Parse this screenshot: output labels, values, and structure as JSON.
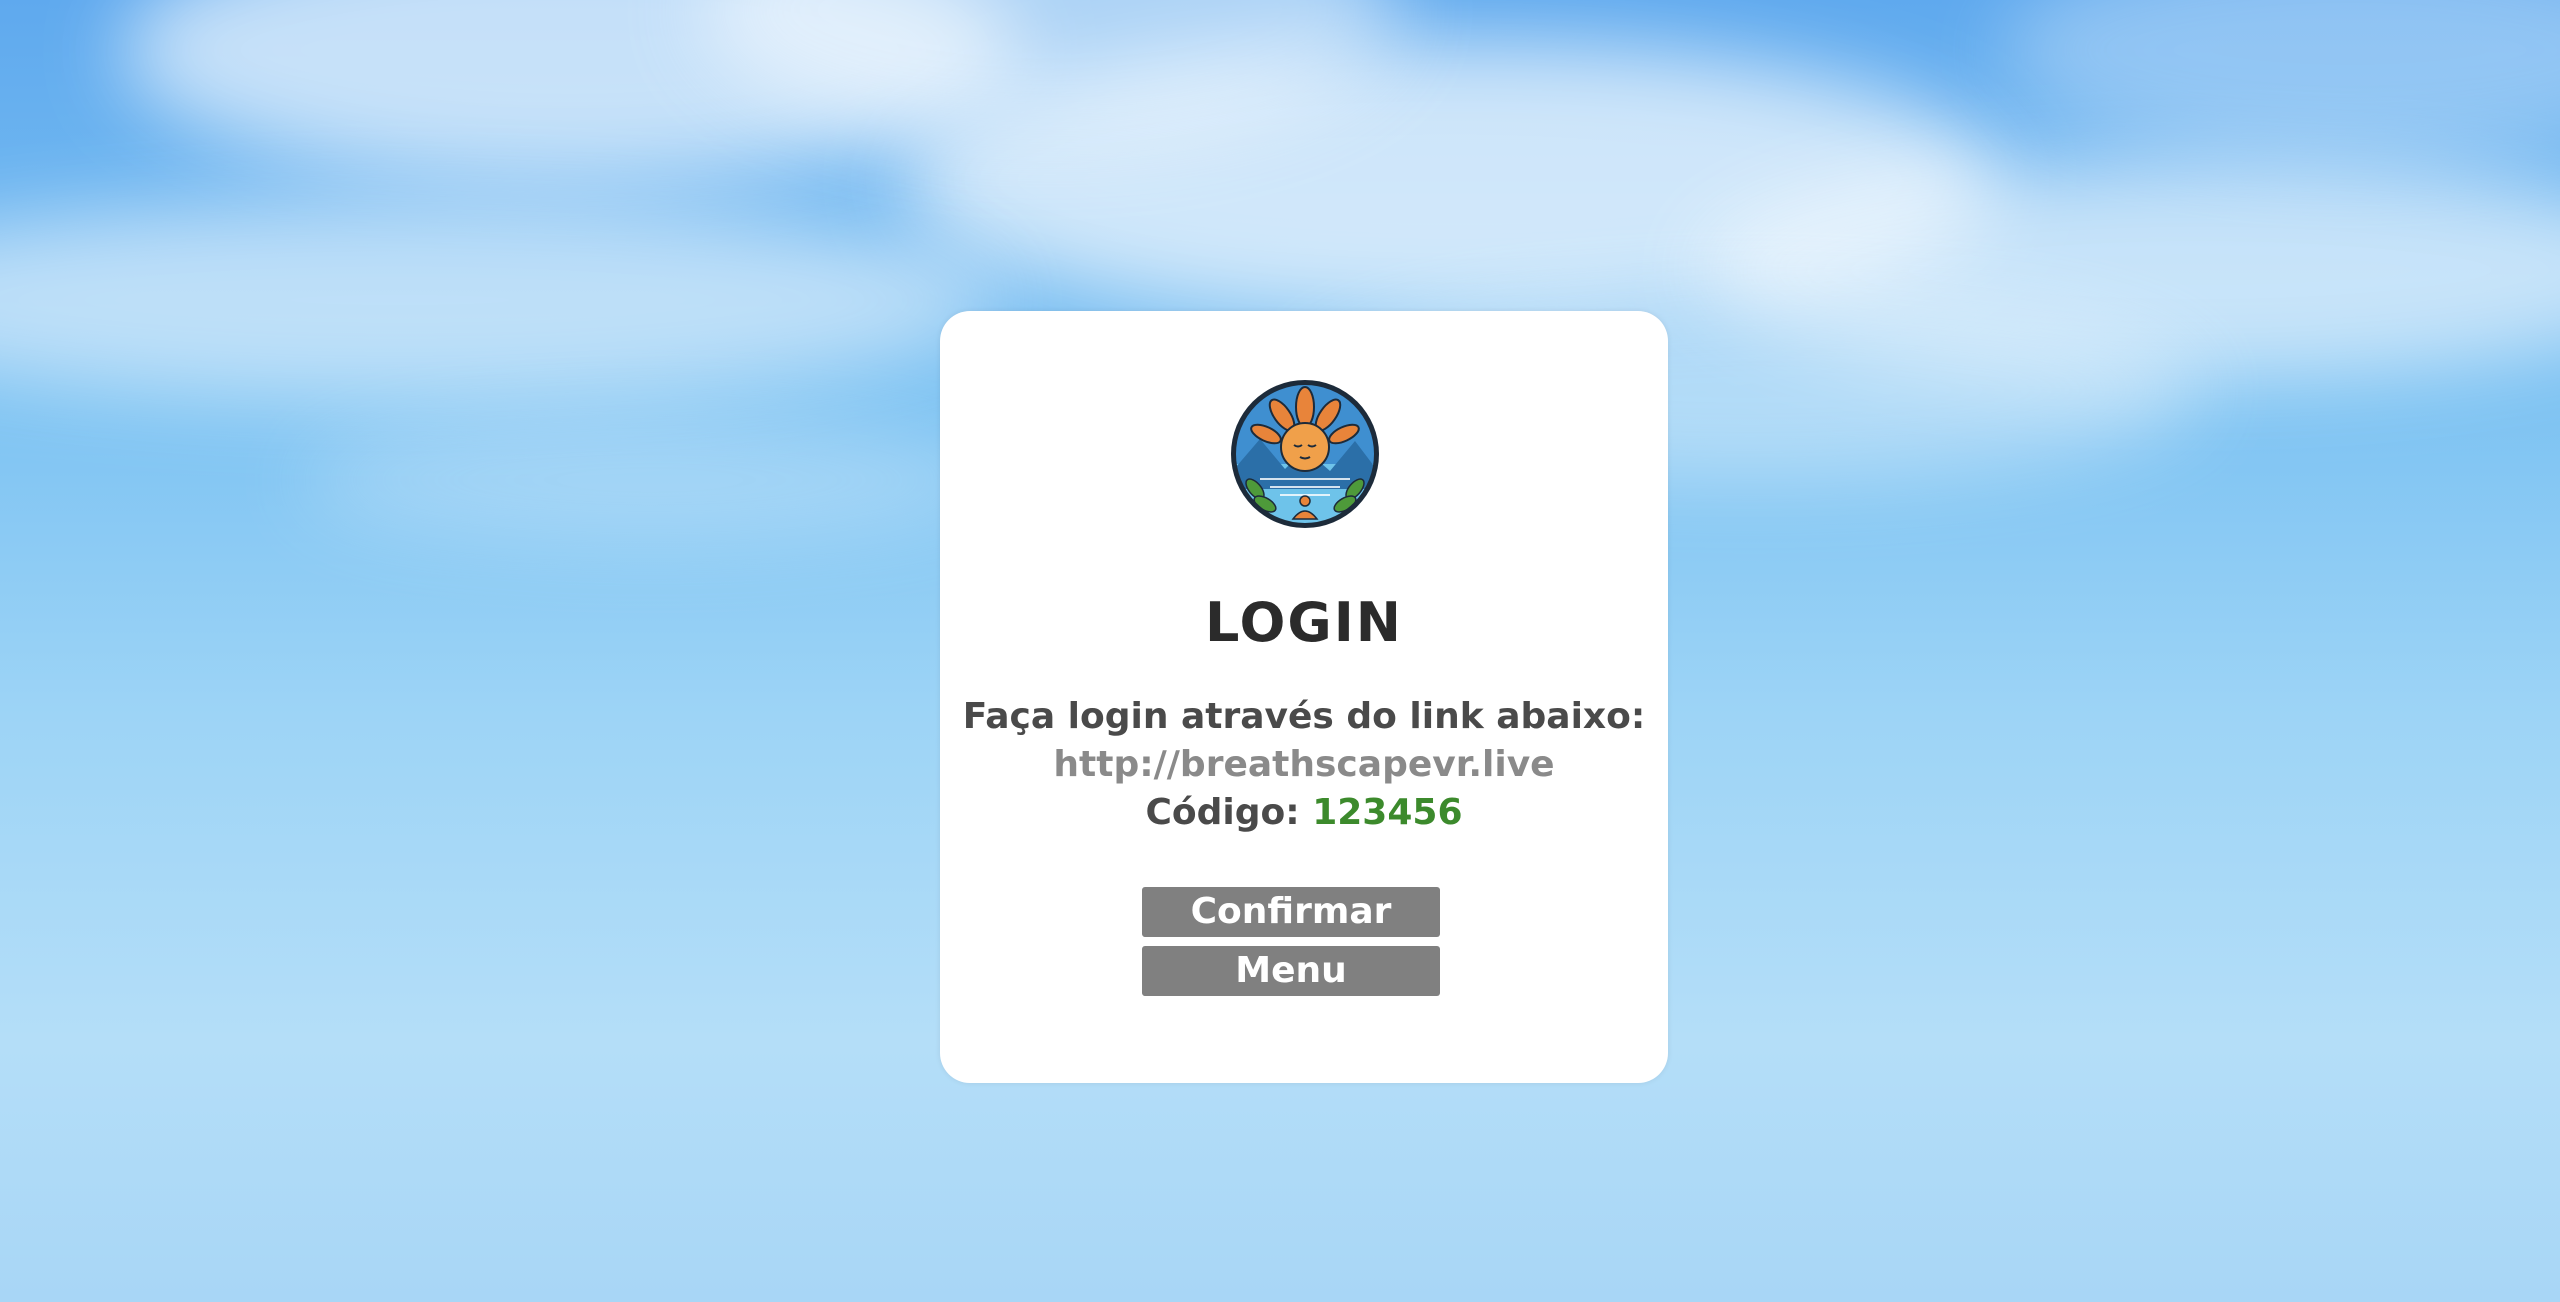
{
  "login": {
    "title": "LOGIN",
    "instruction": "Faça login através do link abaixo:",
    "link": "http://breathscapevr.live",
    "code_label": "Código:",
    "code_value": "123456",
    "confirm_label": "Confirmar",
    "menu_label": "Menu",
    "logo_icon": "meditation-sun-logo-icon"
  },
  "colors": {
    "code": "#3c8a2c",
    "button": "#808080",
    "title": "#2b2b2b"
  }
}
